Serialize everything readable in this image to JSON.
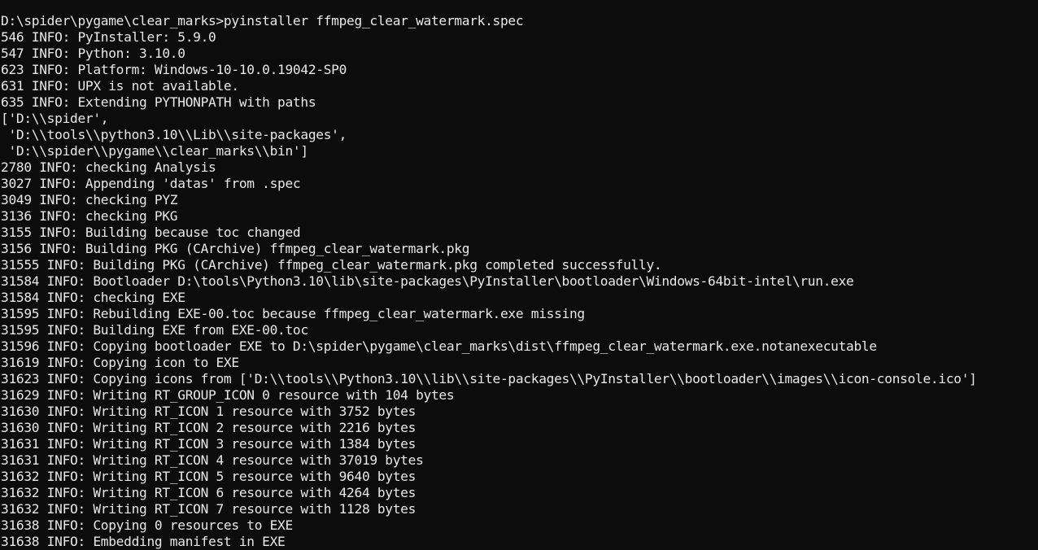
{
  "console": {
    "lines": [
      "D:\\spider\\pygame\\clear_marks>pyinstaller ffmpeg_clear_watermark.spec",
      "546 INFO: PyInstaller: 5.9.0",
      "547 INFO: Python: 3.10.0",
      "623 INFO: Platform: Windows-10-10.0.19042-SP0",
      "631 INFO: UPX is not available.",
      "635 INFO: Extending PYTHONPATH with paths",
      "['D:\\\\spider',",
      " 'D:\\\\tools\\\\python3.10\\\\Lib\\\\site-packages',",
      " 'D:\\\\spider\\\\pygame\\\\clear_marks\\\\bin']",
      "2780 INFO: checking Analysis",
      "3027 INFO: Appending 'datas' from .spec",
      "3049 INFO: checking PYZ",
      "3136 INFO: checking PKG",
      "3155 INFO: Building because toc changed",
      "3156 INFO: Building PKG (CArchive) ffmpeg_clear_watermark.pkg",
      "31555 INFO: Building PKG (CArchive) ffmpeg_clear_watermark.pkg completed successfully.",
      "31584 INFO: Bootloader D:\\tools\\Python3.10\\lib\\site-packages\\PyInstaller\\bootloader\\Windows-64bit-intel\\run.exe",
      "31584 INFO: checking EXE",
      "31595 INFO: Rebuilding EXE-00.toc because ffmpeg_clear_watermark.exe missing",
      "31595 INFO: Building EXE from EXE-00.toc",
      "31596 INFO: Copying bootloader EXE to D:\\spider\\pygame\\clear_marks\\dist\\ffmpeg_clear_watermark.exe.notanexecutable",
      "31619 INFO: Copying icon to EXE",
      "31623 INFO: Copying icons from ['D:\\\\tools\\\\Python3.10\\\\lib\\\\site-packages\\\\PyInstaller\\\\bootloader\\\\images\\\\icon-console.ico']",
      "31629 INFO: Writing RT_GROUP_ICON 0 resource with 104 bytes",
      "31630 INFO: Writing RT_ICON 1 resource with 3752 bytes",
      "31630 INFO: Writing RT_ICON 2 resource with 2216 bytes",
      "31631 INFO: Writing RT_ICON 3 resource with 1384 bytes",
      "31631 INFO: Writing RT_ICON 4 resource with 37019 bytes",
      "31632 INFO: Writing RT_ICON 5 resource with 9640 bytes",
      "31632 INFO: Writing RT_ICON 6 resource with 4264 bytes",
      "31632 INFO: Writing RT_ICON 7 resource with 1128 bytes",
      "31638 INFO: Copying 0 resources to EXE",
      "31638 INFO: Embedding manifest in EXE"
    ]
  },
  "colors": {
    "background": "#0c0c0c",
    "text": "#e8e8e8"
  }
}
